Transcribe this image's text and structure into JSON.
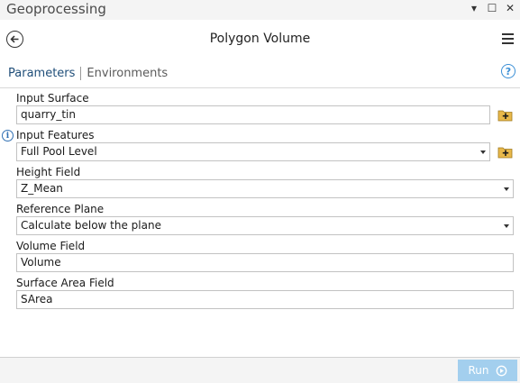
{
  "pane": {
    "title": "Geoprocessing"
  },
  "window_controls": [
    {
      "name": "dropdown-icon",
      "glyph": "▾"
    },
    {
      "name": "maximize-icon",
      "glyph": "☐"
    },
    {
      "name": "close-icon",
      "glyph": "✕"
    }
  ],
  "tool": {
    "title": "Polygon Volume"
  },
  "tabs": {
    "active": "Parameters",
    "inactive": "Environments"
  },
  "help": {
    "glyph": "?"
  },
  "params": {
    "input_surface": {
      "label": "Input Surface",
      "value": "quarry_tin"
    },
    "input_features": {
      "label": "Input Features",
      "value": "Full Pool Level"
    },
    "height_field": {
      "label": "Height Field",
      "value": "Z_Mean"
    },
    "reference_plane": {
      "label": "Reference Plane",
      "value": "Calculate below the plane"
    },
    "volume_field": {
      "label": "Volume Field",
      "value": "Volume"
    },
    "surface_area_field": {
      "label": "Surface Area Field",
      "value": "SArea"
    }
  },
  "footer": {
    "run_label": "Run"
  },
  "colors": {
    "accent": "#1f4e79",
    "run_button": "#a3cfee",
    "help": "#3a8fd6",
    "browse_icon": "#e8b84a"
  }
}
